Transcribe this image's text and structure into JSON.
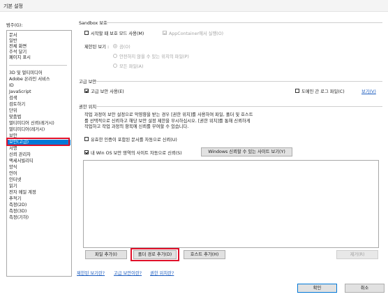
{
  "window": {
    "title": "기본 설정"
  },
  "categories_label": "범주(G):",
  "sidebar": {
    "group1": [
      "문서",
      "일반",
      "전체 화면",
      "주석 달기",
      "페이지 표시"
    ],
    "group2": [
      "3D 및 멀티미디어",
      "Adobe 온라인 서비스",
      "ID",
      "JavaScript",
      "검색",
      "검토하기",
      "단위",
      "맞춤법",
      "멀티미디어 신뢰(레거시)",
      "멀티미디어(레거시)",
      "보안",
      "보안(고급)",
      "서명",
      "신뢰 관리자",
      "액세서빌리티",
      "양식",
      "언어",
      "인터넷",
      "읽기",
      "전자 메일 계정",
      "추적기",
      "측정(2D)",
      "측정(3D)",
      "측정(기하)"
    ],
    "selected": "보안(고급)"
  },
  "sandbox": {
    "title": "Sandbox 보호",
    "startup_protected_mode": {
      "label": "시작할 때 보호 모드 사용(M)",
      "checked": false
    },
    "appcontainer": {
      "label": "AppContainer에서 실행(O)",
      "checked": true,
      "disabled": true
    },
    "protected_view_label": "제한된 보기 :",
    "protected_view_options": [
      {
        "label": "끔(O)",
        "selected": true
      },
      {
        "label": "안전하지 않을 수 있는 위치의 파일(P)",
        "selected": false
      },
      {
        "label": "모든 파일(A)",
        "selected": false
      }
    ]
  },
  "enhanced_security": {
    "title": "고급 보안",
    "enable": {
      "label": "고급 보안 사용(E)",
      "checked": true
    },
    "cross_domain_log": {
      "label": "도메인 간 로그 파일(C)",
      "checked": false
    },
    "view_link": "보기(V)"
  },
  "privileged_locations": {
    "title": "권한 위치",
    "description": [
      "작업 과정이 보안 설정으로 악영향을 받는 경우 [권한 위치]를 사용하여 파일, 폴더 및 호스트",
      "를 선택적으로 신뢰하고 해당 보안 설정 제한을 무시하십시오. [권한 위치]를 통해 신뢰하게",
      "작업하고 작업 과정의 항목에 신뢰를 부여할 수 있습니다."
    ],
    "auto_trust_certified": {
      "label": "유효한 인증이 포함된 문서를 자동으로 신뢰(U)",
      "checked": false
    },
    "auto_trust_win_os": {
      "label": "내 Win OS 보안 영역의 사이트 자동으로 신뢰(S)",
      "checked": true
    },
    "view_windows_trusted_sites_button": "Windows 신뢰할 수 있는 사이트 보기(Y)",
    "list_items": [],
    "add_file_button": "파일 추가(I)",
    "add_folder_path_button": "폴더 경로 추가(D)",
    "add_host_button": "호스트 추가(H)",
    "remove_button": "제거(R)"
  },
  "help_links": [
    "제한된 보기란?",
    "고급 보안이란?",
    "권한 위치란?"
  ],
  "footer": {
    "ok_button": "확인",
    "cancel_button": "취소"
  },
  "colors": {
    "selection": "#0078d7",
    "highlight_box": "#e0102a",
    "link": "#1a5bbf"
  }
}
